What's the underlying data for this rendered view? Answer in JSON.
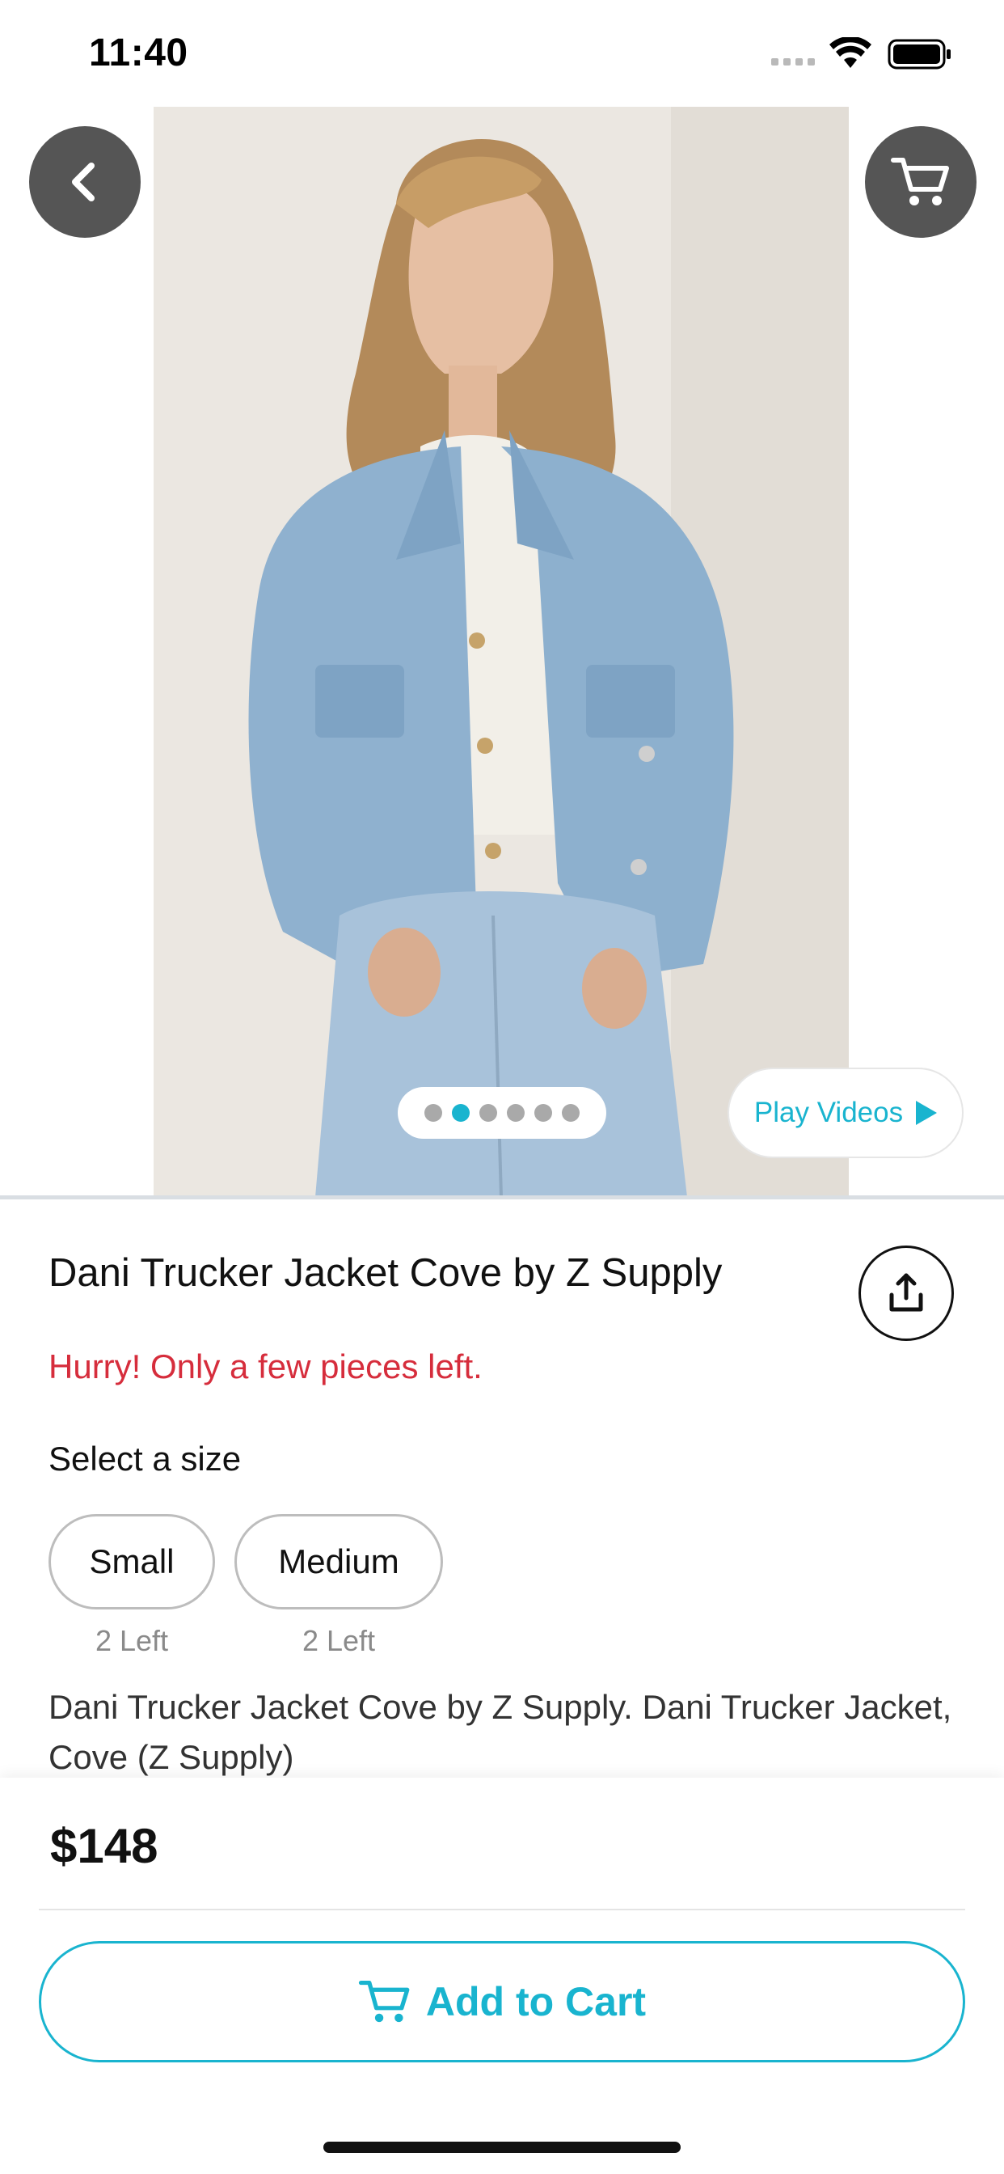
{
  "status_bar": {
    "time": "11:40"
  },
  "header": {
    "back_icon": "chevron-left-icon",
    "cart_icon": "cart-icon"
  },
  "gallery": {
    "image": "model-wearing-denim-jacket",
    "page_count": 6,
    "active_page": 2,
    "play_videos_label": "Play Videos"
  },
  "product": {
    "title": "Dani Trucker Jacket Cove by Z Supply",
    "stock_warning": "Hurry! Only a few pieces left.",
    "size_heading": "Select a size",
    "sizes": [
      {
        "label": "Small",
        "stock": "2 Left"
      },
      {
        "label": "Medium",
        "stock": "2 Left"
      }
    ],
    "description": "Dani Trucker Jacket Cove by Z Supply. Dani Trucker Jacket, Cove (Z Supply)",
    "share_icon": "share-icon"
  },
  "purchase": {
    "price": "$148",
    "add_to_cart_label": "Add to Cart"
  },
  "colors": {
    "accent": "#19b4cf",
    "warning": "#d62d3c",
    "circle_button": "#555555"
  }
}
